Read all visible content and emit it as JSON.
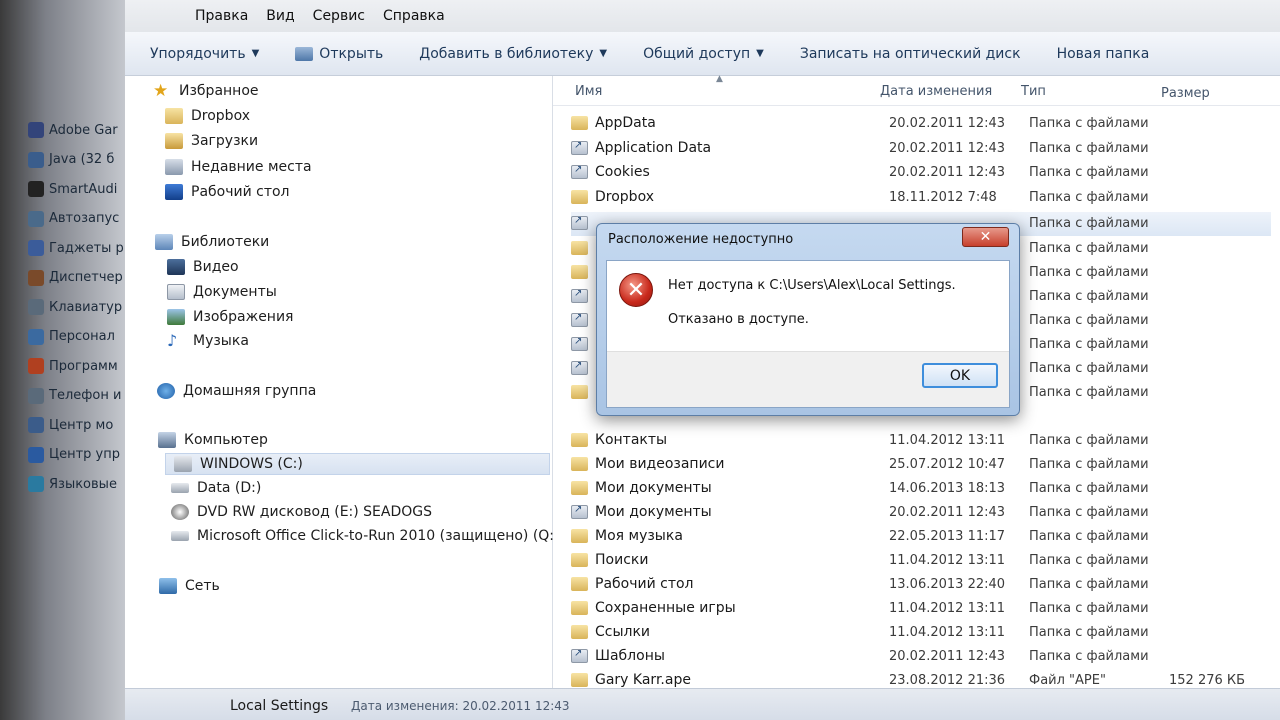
{
  "left_strip": {
    "items": [
      {
        "label": "Adobe Gar",
        "icon": "adobe-gamma-icon",
        "color": "#33447a"
      },
      {
        "label": "Java (32 б",
        "icon": "java-icon",
        "color": "#3a5d8c"
      },
      {
        "label": "SmartAudi",
        "icon": "audio-icon",
        "color": "#222222"
      },
      {
        "label": "Автозапус",
        "icon": "autoplay-icon",
        "color": "#4a6a8a"
      },
      {
        "label": "Гаджеты р",
        "icon": "gadgets-icon",
        "color": "#3b5c9a"
      },
      {
        "label": "Диспетчер",
        "icon": "device-manager-icon",
        "color": "#7a4a2a"
      },
      {
        "label": "Клавиатур",
        "icon": "keyboard-icon",
        "color": "#5a6a7a"
      },
      {
        "label": "Персонал",
        "icon": "personalization-icon",
        "color": "#3b6aa0"
      },
      {
        "label": "Программ",
        "icon": "programs-icon",
        "color": "#b04020"
      },
      {
        "label": "Телефон и",
        "icon": "phone-icon",
        "color": "#5a6a7a"
      },
      {
        "label": "Центр мо",
        "icon": "mobility-center-icon",
        "color": "#3b5c8a"
      },
      {
        "label": "Центр упр",
        "icon": "ease-of-access-icon",
        "color": "#2a5aa0"
      },
      {
        "label": "Языковые",
        "icon": "language-icon",
        "color": "#2a7aa0"
      }
    ]
  },
  "menubar": {
    "items": [
      "Правка",
      "Вид",
      "Сервис",
      "Справка"
    ]
  },
  "toolbar": {
    "organize": "Упорядочить",
    "open": "Открыть",
    "add_to_library": "Добавить в библиотеку",
    "share": "Общий доступ",
    "burn": "Записать на оптический диск",
    "new_folder": "Новая папка"
  },
  "navpane": {
    "favorites": "Избранное",
    "dropbox": "Dropbox",
    "downloads": "Загрузки",
    "recent": "Недавние места",
    "desktop": "Рабочий стол",
    "libraries": "Библиотеки",
    "video": "Видео",
    "documents": "Документы",
    "pictures": "Изображения",
    "music": "Музыка",
    "homegroup": "Домашняя группа",
    "computer": "Компьютер",
    "drive_c": "WINDOWS (C:)",
    "drive_d": "Data (D:)",
    "drive_e": "DVD RW дисковод (E:) SEADOGS",
    "drive_q": "Microsoft Office Click-to-Run 2010 (защищено) (Q:)",
    "network": "Сеть"
  },
  "columns": {
    "name": "Имя",
    "date": "Дата изменения",
    "type": "Тип",
    "size": "Размер"
  },
  "files": [
    {
      "name": "AppData",
      "date": "20.02.2011 12:43",
      "type": "Папка с файлами",
      "size": "",
      "link": false
    },
    {
      "name": "Application Data",
      "date": "20.02.2011 12:43",
      "type": "Папка с файлами",
      "size": "",
      "link": true
    },
    {
      "name": "Cookies",
      "date": "20.02.2011 12:43",
      "type": "Папка с файлами",
      "size": "",
      "link": true
    },
    {
      "name": "Dropbox",
      "date": "18.11.2012 7:48",
      "type": "Папка с файлами",
      "size": "",
      "link": false
    },
    {
      "name": "",
      "date": "",
      "type": "Папка с файлами",
      "size": "",
      "link": true
    },
    {
      "name": "",
      "date": "",
      "type": "Папка с файлами",
      "size": "",
      "link": false
    },
    {
      "name": "",
      "date": "",
      "type": "Папка с файлами",
      "size": "",
      "link": false
    },
    {
      "name": "",
      "date": "",
      "type": "Папка с файлами",
      "size": "",
      "link": true
    },
    {
      "name": "",
      "date": "",
      "type": "Папка с файлами",
      "size": "",
      "link": true
    },
    {
      "name": "",
      "date": "",
      "type": "Папка с файлами",
      "size": "",
      "link": true
    },
    {
      "name": "",
      "date": "",
      "type": "Папка с файлами",
      "size": "",
      "link": true
    },
    {
      "name": "",
      "date": "",
      "type": "Папка с файлами",
      "size": "",
      "link": false
    },
    {
      "name": "Контакты",
      "date": "11.04.2012 13:11",
      "type": "Папка с файлами",
      "size": "",
      "link": false
    },
    {
      "name": "Мои видеозаписи",
      "date": "25.07.2012 10:47",
      "type": "Папка с файлами",
      "size": "",
      "link": false
    },
    {
      "name": "Мои документы",
      "date": "14.06.2013 18:13",
      "type": "Папка с файлами",
      "size": "",
      "link": false
    },
    {
      "name": "Мои документы",
      "date": "20.02.2011 12:43",
      "type": "Папка с файлами",
      "size": "",
      "link": true
    },
    {
      "name": "Моя музыка",
      "date": "22.05.2013 11:17",
      "type": "Папка с файлами",
      "size": "",
      "link": false
    },
    {
      "name": "Поиски",
      "date": "11.04.2012 13:11",
      "type": "Папка с файлами",
      "size": "",
      "link": false
    },
    {
      "name": "Рабочий стол",
      "date": "13.06.2013 22:40",
      "type": "Папка с файлами",
      "size": "",
      "link": false
    },
    {
      "name": "Сохраненные игры",
      "date": "11.04.2012 13:11",
      "type": "Папка с файлами",
      "size": "",
      "link": false
    },
    {
      "name": "Ссылки",
      "date": "11.04.2012 13:11",
      "type": "Папка с файлами",
      "size": "",
      "link": false
    },
    {
      "name": "Шаблоны",
      "date": "20.02.2011 12:43",
      "type": "Папка с файлами",
      "size": "",
      "link": true
    },
    {
      "name": "Gary Karr.ape",
      "date": "23.08.2012 21:36",
      "type": "Файл \"APE\"",
      "size": "152 276 КБ",
      "link": false
    }
  ],
  "statusbar": {
    "selected_name": "Local Settings",
    "meta": "Дата изменения: 20.02.2011 12:43"
  },
  "dialog": {
    "title": "Расположение недоступно",
    "close_glyph": "✕",
    "message": "Нет доступа к C:\\Users\\Alex\\Local Settings.",
    "detail": "Отказано в доступе.",
    "ok": "OK"
  },
  "colors": {
    "accent": "#3e8edc",
    "error_red": "#c8281b"
  }
}
